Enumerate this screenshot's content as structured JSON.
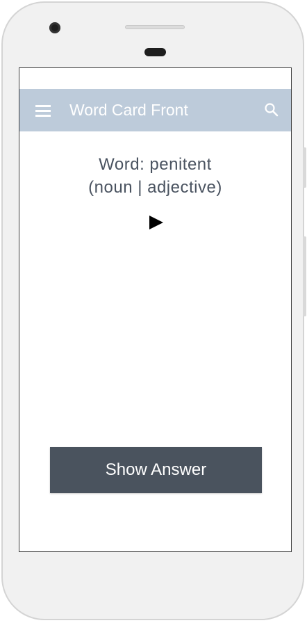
{
  "app_bar": {
    "title": "Word Card Front",
    "menu_icon": "hamburger-menu-icon",
    "search_icon": "search-icon",
    "background": "#bdcbda"
  },
  "card": {
    "word_line": "Word: penitent",
    "part_of_speech": "(noun | adjective)",
    "play_icon": "play-audio-icon",
    "text_color": "#4a5360"
  },
  "actions": {
    "show_answer_label": "Show Answer",
    "button_color": "#4a535e"
  }
}
